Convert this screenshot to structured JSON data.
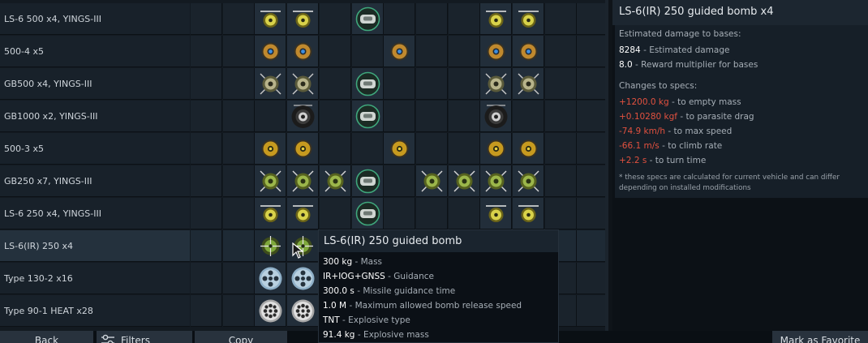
{
  "rows": [
    {
      "label": "LS-6 500 x4,  YINGS-III",
      "slots": [
        {
          "col": 2,
          "type": "ls6"
        },
        {
          "col": 3,
          "type": "ls6"
        },
        {
          "col": 5,
          "type": "pod"
        },
        {
          "col": 9,
          "type": "ls6"
        },
        {
          "col": 10,
          "type": "ls6"
        }
      ]
    },
    {
      "label": "500-4 x5",
      "slots": [
        {
          "col": 2,
          "type": "bomb-blue"
        },
        {
          "col": 3,
          "type": "bomb-blue"
        },
        {
          "col": 6,
          "type": "bomb-blue"
        },
        {
          "col": 9,
          "type": "bomb-blue"
        },
        {
          "col": 10,
          "type": "bomb-blue"
        }
      ]
    },
    {
      "label": "GB500 x4,  YINGS-III",
      "slots": [
        {
          "col": 2,
          "type": "gb"
        },
        {
          "col": 3,
          "type": "gb"
        },
        {
          "col": 5,
          "type": "pod"
        },
        {
          "col": 9,
          "type": "gb"
        },
        {
          "col": 10,
          "type": "gb"
        }
      ]
    },
    {
      "label": "GB1000 x2,  YINGS-III",
      "slots": [
        {
          "col": 3,
          "type": "gb-big"
        },
        {
          "col": 5,
          "type": "pod"
        },
        {
          "col": 9,
          "type": "gb-big"
        }
      ]
    },
    {
      "label": "500-3 x5",
      "slots": [
        {
          "col": 2,
          "type": "bomb-yellow"
        },
        {
          "col": 3,
          "type": "bomb-yellow"
        },
        {
          "col": 6,
          "type": "bomb-yellow"
        },
        {
          "col": 9,
          "type": "bomb-yellow"
        },
        {
          "col": 10,
          "type": "bomb-yellow"
        }
      ]
    },
    {
      "label": "GB250 x7,  YINGS-III",
      "slots": [
        {
          "col": 2,
          "type": "gb-green"
        },
        {
          "col": 3,
          "type": "gb-green"
        },
        {
          "col": 4,
          "type": "gb-green"
        },
        {
          "col": 5,
          "type": "pod"
        },
        {
          "col": 7,
          "type": "gb-green"
        },
        {
          "col": 8,
          "type": "gb-green"
        },
        {
          "col": 9,
          "type": "gb-green"
        },
        {
          "col": 10,
          "type": "gb-green"
        }
      ]
    },
    {
      "label": "LS-6 250 x4,  YINGS-III",
      "slots": [
        {
          "col": 2,
          "type": "ls6"
        },
        {
          "col": 3,
          "type": "ls6"
        },
        {
          "col": 5,
          "type": "pod"
        },
        {
          "col": 9,
          "type": "ls6"
        },
        {
          "col": 10,
          "type": "ls6"
        }
      ]
    },
    {
      "label": "LS-6(IR) 250 x4",
      "selected": true,
      "slots": [
        {
          "col": 2,
          "type": "ir"
        },
        {
          "col": 3,
          "type": "ir"
        }
      ]
    },
    {
      "label": "Type 130-2 x16",
      "slots": [
        {
          "col": 2,
          "type": "rocket"
        },
        {
          "col": 3,
          "type": "rocket"
        }
      ]
    },
    {
      "label": "Type 90-1 HEAT x28",
      "slots": [
        {
          "col": 2,
          "type": "heat"
        },
        {
          "col": 3,
          "type": "heat"
        }
      ]
    }
  ],
  "right_panel": {
    "title": "LS-6(IR) 250 guided bomb x4",
    "bases_header": "Estimated damage to bases:",
    "damage_value": "8284",
    "damage_label": "- Estimated damage",
    "reward_value": "8.0",
    "reward_label": "- Reward multiplier for bases",
    "changes_header": "Changes to specs:",
    "changes": [
      {
        "value": "+1200.0 kg",
        "label": "- to empty mass"
      },
      {
        "value": "+0.10280 kgf",
        "label": "- to parasite drag"
      },
      {
        "value": "-74.9 km/h",
        "label": "- to max speed"
      },
      {
        "value": "-66.1 m/s",
        "label": "- to climb rate"
      },
      {
        "value": "+2.2 s",
        "label": "- to turn time"
      }
    ],
    "note_line1": "* these specs are calculated for current vehicle and can differ",
    "note_line2": "depending on installed modifications"
  },
  "tooltip": {
    "title": "LS-6(IR) 250 guided bomb",
    "specs": [
      {
        "value": "300 kg",
        "label": "- Mass"
      },
      {
        "value": "IR+IOG+GNSS",
        "label": "- Guidance"
      },
      {
        "value": "300.0 s",
        "label": "- Missile guidance time"
      },
      {
        "value": "1.0 M",
        "label": "- Maximum allowed bomb release speed"
      },
      {
        "value": "TNT",
        "label": "- Explosive type"
      },
      {
        "value": "91.4 kg",
        "label": "- Explosive mass"
      }
    ]
  },
  "bottom_bar": {
    "back": "Back",
    "filters": "Filters",
    "copy": "Copy",
    "favorite": "Mark as Favorite"
  },
  "icon_names": [
    "ls6-bomb-icon",
    "gb-bomb-icon",
    "pod-icon",
    "rocket-pod-icon",
    "heat-pod-icon",
    "filters-icon",
    "cursor-icon"
  ],
  "colors": {
    "accent_red": "#e2513f",
    "guided_yellow": "#d8d24a",
    "gb_green": "#9bb64a",
    "ir_green": "#7ea83b",
    "pod_teal": "#3fa77c"
  }
}
